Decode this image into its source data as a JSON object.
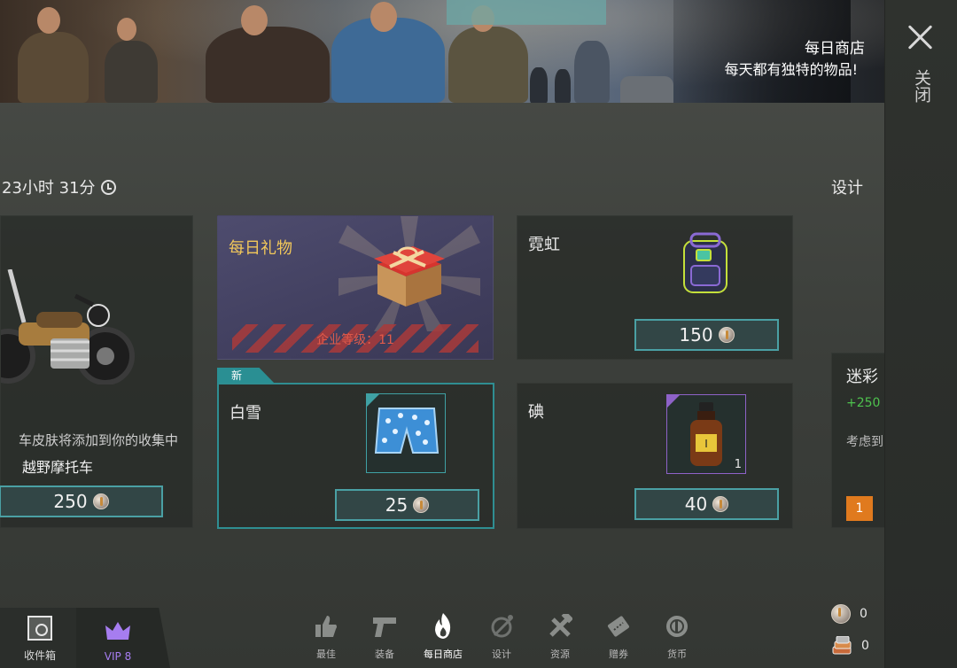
{
  "banner": {
    "title": "每日商店",
    "subtitle": "每天都有独特的物品!"
  },
  "rail": {
    "close_label": "关闭"
  },
  "shop": {
    "timer": "23小时 31分",
    "design_link": "设计"
  },
  "cards": {
    "moto": {
      "desc": "车皮肤将添加到你的收集中",
      "name": "越野摩托车",
      "price": "250"
    },
    "gift": {
      "title": "每日礼物",
      "level": "企业等级：11"
    },
    "neon": {
      "name": "霓虹",
      "price": "150"
    },
    "snow": {
      "tag": "新",
      "name": "白雪",
      "price": "25"
    },
    "iodine": {
      "name": "碘",
      "qty": "1",
      "price": "40"
    },
    "camo": {
      "name": "迷彩",
      "bonus": "+250 ",
      "note": "考虑到",
      "badge": "1"
    }
  },
  "bottom": {
    "collection_label": "收件箱",
    "vip_label": "VIP 8",
    "tabs": [
      {
        "label": "最佳",
        "icon": "thumbs-up-icon"
      },
      {
        "label": "装备",
        "icon": "pistol-icon"
      },
      {
        "label": "每日商店",
        "icon": "flame-icon"
      },
      {
        "label": "设计",
        "icon": "spray-can-icon"
      },
      {
        "label": "资源",
        "icon": "tools-icon"
      },
      {
        "label": "赠券",
        "icon": "ticket-icon"
      },
      {
        "label": "货币",
        "icon": "coin-icon"
      }
    ],
    "currency": [
      {
        "icon": "silver-coin-icon",
        "value": "0"
      },
      {
        "icon": "resource-stack-icon",
        "value": "0"
      }
    ]
  },
  "colors": {
    "accent_teal": "#3fa1a4",
    "gift_gold": "#f2c85a",
    "gift_level_red": "#e25b4b",
    "vip_purple": "#a67df0",
    "badge_orange": "#e07a1e",
    "bonus_green": "#4ec24e"
  }
}
